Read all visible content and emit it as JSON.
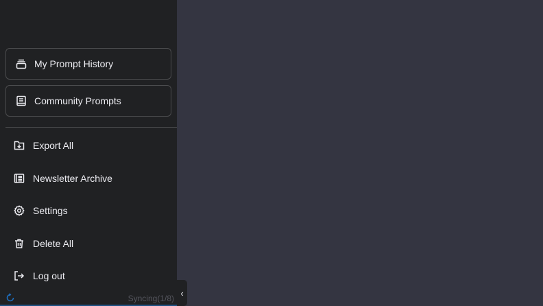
{
  "sidebar": {
    "primary_buttons": [
      {
        "label": "My Prompt History",
        "icon": "stack-icon"
      },
      {
        "label": "Community Prompts",
        "icon": "book-icon"
      }
    ],
    "menu_items": [
      {
        "label": "Export All",
        "icon": "export-icon"
      },
      {
        "label": "Newsletter Archive",
        "icon": "newsletter-icon"
      },
      {
        "label": "Settings",
        "icon": "gear-icon"
      },
      {
        "label": "Delete All",
        "icon": "trash-icon"
      },
      {
        "label": "Log out",
        "icon": "logout-icon"
      }
    ],
    "sync_status": "Syncing(1/8)",
    "collapse_label": "‹"
  },
  "colors": {
    "sidebar_bg": "#202123",
    "main_bg": "#343541",
    "text": "#ececf1",
    "sync_icon": "#1e6fbf"
  }
}
